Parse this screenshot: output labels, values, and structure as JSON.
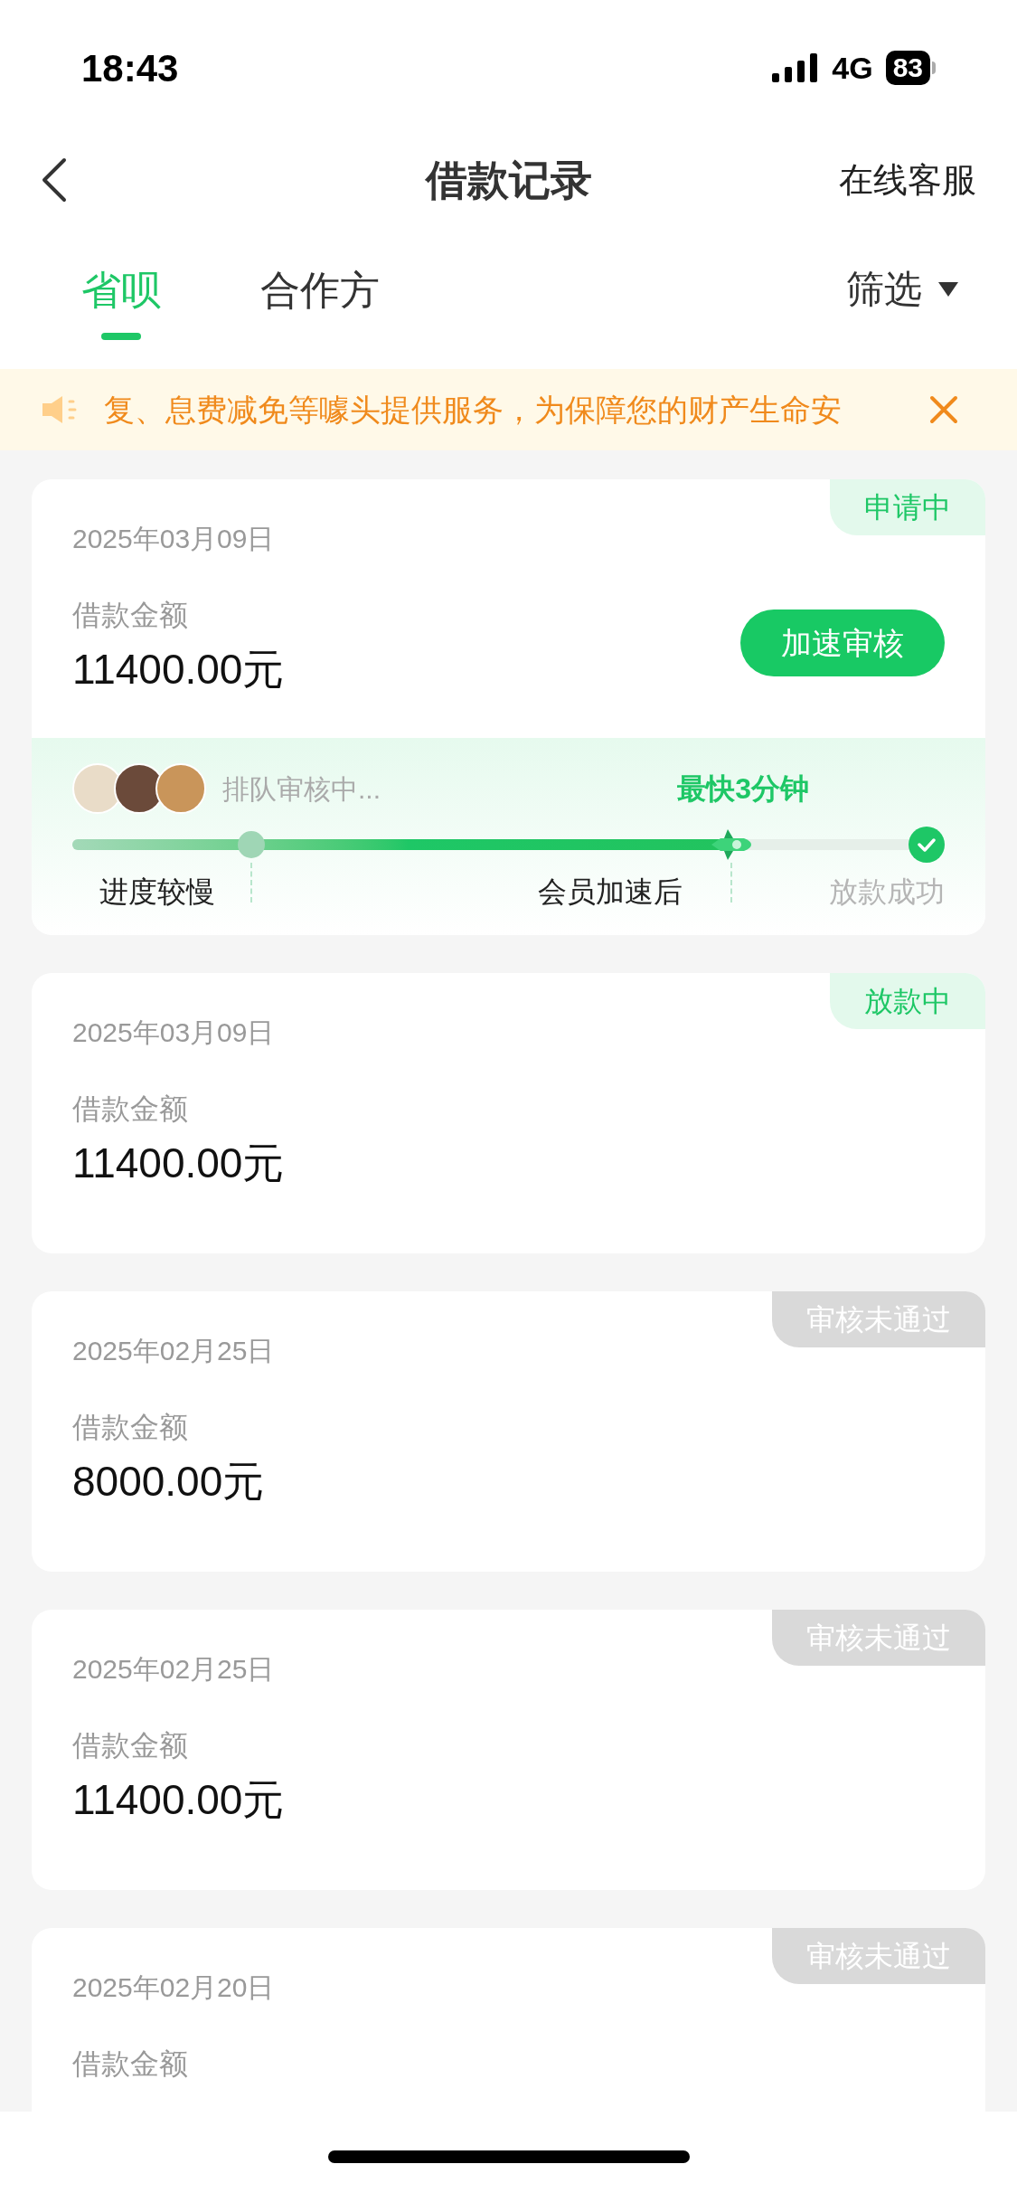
{
  "status_bar": {
    "time": "18:43",
    "network": "4G",
    "battery": "83"
  },
  "nav": {
    "title": "借款记录",
    "action": "在线客服"
  },
  "tabs": [
    {
      "label": "省呗",
      "selected": true
    },
    {
      "label": "合作方",
      "selected": false
    }
  ],
  "filter": {
    "label": "筛选"
  },
  "notice": {
    "text": "复、息费减免等噱头提供服务，为保障您的财产生命安"
  },
  "loans": [
    {
      "kind": "applying",
      "status": "申请中",
      "date": "2025年03月09日",
      "amount_label": "借款金额",
      "amount": "11400.00元",
      "button": "加速审核",
      "progress": {
        "queue_text": "排队审核中...",
        "eta": "最快3分钟",
        "level": 0.77,
        "labels": [
          "进度较慢",
          "会员加速后",
          "放款成功"
        ]
      }
    },
    {
      "kind": "disbursing",
      "status": "放款中",
      "date": "2025年03月09日",
      "amount_label": "借款金额",
      "amount": "11400.00元"
    },
    {
      "kind": "rejected",
      "status": "审核未通过",
      "date": "2025年02月25日",
      "amount_label": "借款金额",
      "amount": "8000.00元"
    },
    {
      "kind": "rejected",
      "status": "审核未通过",
      "date": "2025年02月25日",
      "amount_label": "借款金额",
      "amount": "11400.00元"
    },
    {
      "kind": "rejected",
      "status": "审核未通过",
      "date": "2025年02月20日",
      "amount_label": "借款金额"
    }
  ]
}
